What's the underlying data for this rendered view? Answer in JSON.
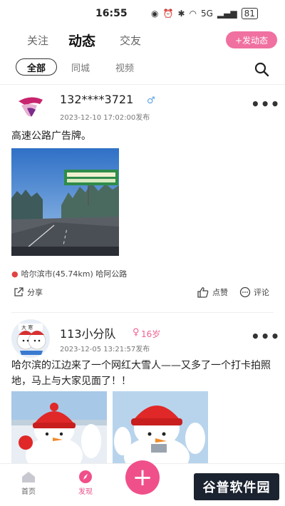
{
  "status": {
    "time": "16:55",
    "network": "5G",
    "battery": "81"
  },
  "top_tabs": [
    "关注",
    "动态",
    "交友"
  ],
  "post_button": "+发动态",
  "filters": [
    "全部",
    "同城",
    "视频"
  ],
  "posts": [
    {
      "username": "132****3721",
      "gender": "♂",
      "age": "",
      "time": "2023-12-10 17:02:00发布",
      "text": "高速公路广告牌。",
      "location": "哈尔滨市(45.74km) 哈阿公路",
      "share": "分享",
      "like": "点赞",
      "comment": "评论"
    },
    {
      "username": "113小分队",
      "gender": "♀",
      "age": "16岁",
      "time": "2023-12-05 13:21:57发布",
      "text": "哈尔滨的江边来了一个网红大雪人——又多了一个打卡拍照地，马上与大家见面了！！"
    }
  ],
  "bottom_nav": {
    "home": "首页",
    "discover": "发现",
    "plus": "+"
  },
  "watermark": "谷普软件园",
  "colors": {
    "accent": "#f0508a",
    "male": "#5aa2e8",
    "female": "#f06090",
    "pin": "#e04444"
  }
}
